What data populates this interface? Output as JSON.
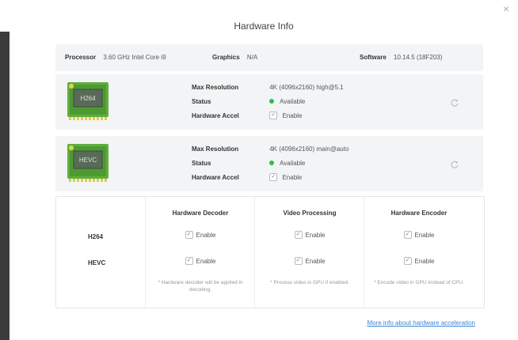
{
  "dialog": {
    "title": "Hardware Info",
    "close_icon": "×"
  },
  "system": {
    "processor_label": "Processor",
    "processor_value": "3.60 GHz Intel Core i9",
    "graphics_label": "Graphics",
    "graphics_value": "N/A",
    "software_label": "Software",
    "software_value": "10.14.5 (18F203)"
  },
  "codecs": [
    {
      "chip_label": "H264",
      "max_resolution_label": "Max Resolution",
      "max_resolution_value": "4K (4096x2160) high@5.1",
      "status_label": "Status",
      "status_value": "Available",
      "hw_accel_label": "Hardware Accel",
      "hw_accel_value": "Enable"
    },
    {
      "chip_label": "HEVC",
      "max_resolution_label": "Max Resolution",
      "max_resolution_value": "4K (4096x2160) main@auto",
      "status_label": "Status",
      "status_value": "Available",
      "hw_accel_label": "Hardware Accel",
      "hw_accel_value": "Enable"
    }
  ],
  "table": {
    "headers": [
      "Hardware Decoder",
      "Video Processing",
      "Hardware Encoder"
    ],
    "rows": [
      {
        "label": "H264",
        "cells": [
          "Enable",
          "Enable",
          "Enable"
        ]
      },
      {
        "label": "HEVC",
        "cells": [
          "Enable",
          "Enable",
          "Enable"
        ]
      }
    ],
    "notes": [
      "* Hardware decoder will be applied in decoding.",
      "* Process video in GPU if enabled.",
      "* Encode video in GPU instead of CPU."
    ]
  },
  "link_text": "More info about hardware acceleration",
  "colors": {
    "status_dot": "#2fbf4a",
    "chip_green": "#5fae3e",
    "link": "#3a86d0"
  }
}
